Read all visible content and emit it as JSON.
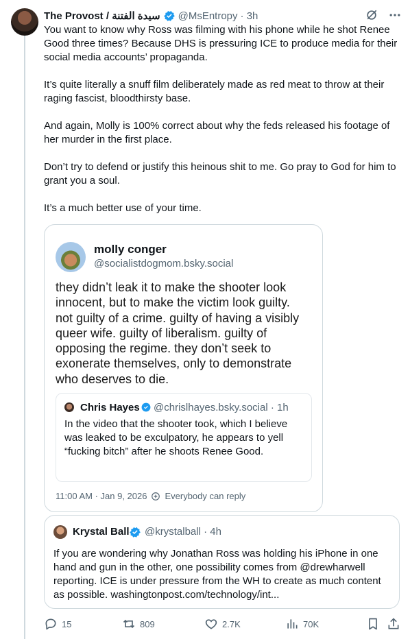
{
  "tweet": {
    "author_name": "The Provost / سيدة الفتنة",
    "handle": "@MsEntropy",
    "time": "· 3h",
    "text": "You want to know why Ross was filming with his phone while he shot Renee Good three times? Because DHS is pressuring ICE to produce media for their social media accounts’ propaganda.\n\nIt’s quite literally a snuff film deliberately made as red meat to throw at their raging fascist, bloodthirsty base.\n\nAnd again, Molly is 100% correct about why the feds released his footage of her murder in the first place.\n\nDon’t try to defend or justify this heinous shit to me. Go pray to God for him to grant you a soul.\n\nIt’s a much better use of your time."
  },
  "embed": {
    "name": "molly conger",
    "handle": "@socialistdogmom.bsky.social",
    "text": "they didn’t leak it to make the shooter look innocent, but to make the victim look guilty. not guilty of a crime. guilty of having a visibly queer wife. guilty of liberalism. guilty of opposing the regime. they don’t seek to exonerate themselves, only to demonstrate who deserves to die.",
    "quote": {
      "name": "Chris Hayes",
      "meta": "@chrislhayes.bsky.social · 1h",
      "text": "In the video that the shooter took, which I believe was leaked to be exculpatory, he appears to yell “fucking bitch” after he shoots Renee Good."
    },
    "timestamp": "11:00 AM · Jan 9, 2026",
    "reply_setting": "Everybody can reply"
  },
  "quoted_tweet": {
    "name": "Krystal Ball",
    "handle": "@krystalball · 4h",
    "text": "If you are wondering why Jonathan Ross was holding his iPhone in one hand and gun in the other, one possibility comes from @drewharwell reporting. ICE is under pressure from the WH to create as much content as possible. washingtonpost.com/technology/int..."
  },
  "metrics": {
    "replies": "15",
    "reposts": "809",
    "likes": "2.7K",
    "views": "70K"
  },
  "icons": [
    "verified-badge-icon",
    "grok-icon",
    "more-icon",
    "reply-icon",
    "repost-icon",
    "like-icon",
    "views-icon",
    "bookmark-icon",
    "share-icon"
  ],
  "colors": {
    "verified": "#1d9bf0",
    "secondary_text": "#536471",
    "border": "#cfd9de"
  }
}
